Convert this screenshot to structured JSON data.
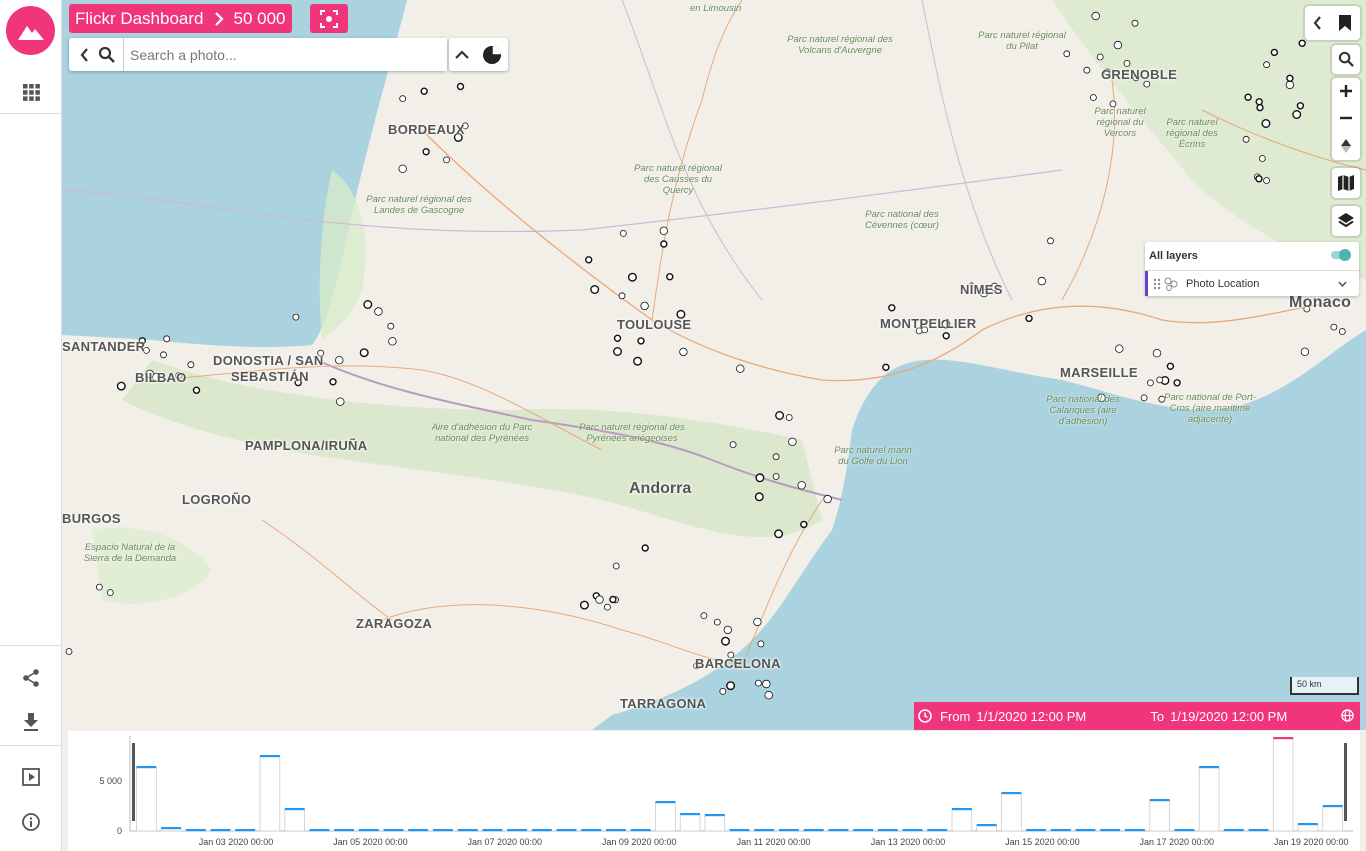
{
  "header": {
    "title": "Flickr Dashboard",
    "count": "50 000"
  },
  "search": {
    "placeholder": "Search a photo..."
  },
  "map": {
    "cities": [
      {
        "name": "BORDEAUX"
      },
      {
        "name": "TOULOUSE"
      },
      {
        "name": "MONTPELLIER"
      },
      {
        "name": "NÎMES"
      },
      {
        "name": "MARSEILLE"
      },
      {
        "name": "GRENOBLE"
      },
      {
        "name": "DONOSTIA / SAN"
      },
      {
        "name": "SEBASTIÁN"
      },
      {
        "name": "BILBAO"
      },
      {
        "name": "PAMPLONA/IRUÑA"
      },
      {
        "name": "LOGROÑO"
      },
      {
        "name": "ZARAGOZA"
      },
      {
        "name": "BARCELONA"
      },
      {
        "name": "TARRAGONA"
      },
      {
        "name": "BURGOS"
      },
      {
        "name": "SANTANDER"
      },
      {
        "name": "Monaco"
      },
      {
        "name": "en Limousin"
      }
    ],
    "country": "Andorra",
    "parks": [
      "Parc naturel régional des Volcans d'Auvergne",
      "Parc naturel régional des Causses du Quercy",
      "Parc naturel régional des Landes de Gascogne",
      "Parc national des Cévennes (cœur)",
      "Parc naturel régional du Pilat",
      "Parc naturel régional du Vercors",
      "Parc naturel régional des Pyrénées ariégeoises",
      "Aire d'adhésion du Parc national des Pyrénées",
      "Parc naturel marin du Golfe du Lion",
      "Parc national des Calanques (aire d'adhésion)",
      "Parc national de Port-Cros (aire maritime adjacente)",
      "Espacio Natural de la Sierra de la Demanda",
      "Parc naturel régional des Écrins"
    ],
    "scale_label": "50 km"
  },
  "layers": {
    "all_label": "All layers",
    "items": [
      {
        "label": "Photo Location",
        "color": "#6a3fc9"
      }
    ]
  },
  "time_filter": {
    "from_label": "From",
    "from_value": "1/1/2020 12:00 PM",
    "to_label": "To",
    "to_value": "1/19/2020 12:00 PM"
  },
  "chart_data": {
    "type": "bar",
    "ylabel": "",
    "yticks": [
      "5 000",
      "0"
    ],
    "ylim": [
      0,
      9500
    ],
    "x_labels": [
      "Jan 03 2020 00:00",
      "Jan 05 2020 00:00",
      "Jan 07 2020 00:00",
      "Jan 09 2020 00:00",
      "Jan 11 2020 00:00",
      "Jan 13 2020 00:00",
      "Jan 15 2020 00:00",
      "Jan 17 2020 00:00",
      "Jan 19 2020 00:00"
    ],
    "values": [
      6400,
      300,
      100,
      100,
      100,
      7500,
      2200,
      100,
      100,
      100,
      100,
      100,
      100,
      100,
      100,
      100,
      100,
      100,
      100,
      100,
      100,
      2900,
      1700,
      1600,
      100,
      100,
      100,
      100,
      100,
      100,
      100,
      100,
      100,
      2200,
      600,
      3800,
      100,
      100,
      100,
      100,
      100,
      3100,
      100,
      6400,
      100,
      100,
      9300,
      700,
      2500
    ],
    "highlight_color": "#f0357a",
    "bar_color": "#2196f3"
  },
  "colors": {
    "accent": "#f0357a",
    "water": "#aad3df"
  }
}
